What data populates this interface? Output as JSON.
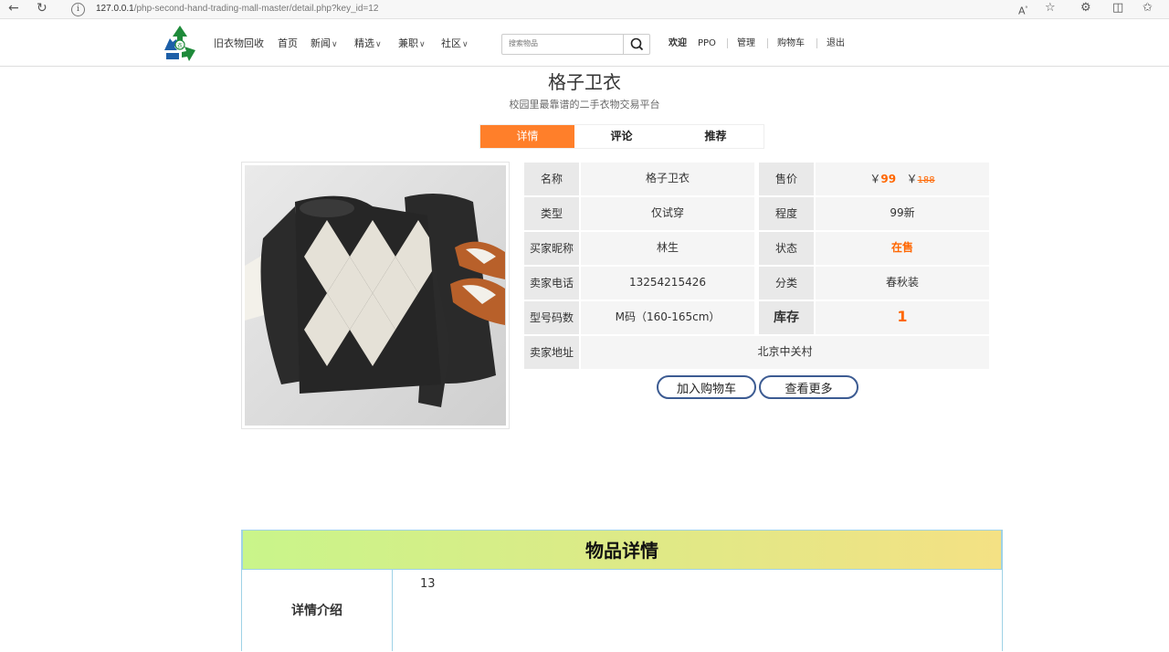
{
  "browser": {
    "url_host": "127.0.0.1",
    "url_path": "/php-second-hand-trading-mall-master/detail.php?key_id=12"
  },
  "site": {
    "brand": "旧衣物回收",
    "nav": [
      {
        "label": "首页",
        "has_caret": false
      },
      {
        "label": "新闻",
        "has_caret": true
      },
      {
        "label": "精选",
        "has_caret": true
      },
      {
        "label": "兼职",
        "has_caret": true
      },
      {
        "label": "社区",
        "has_caret": true
      }
    ],
    "search_placeholder": "搜索物品",
    "welcome": "欢迎",
    "username": "PPO",
    "links": {
      "manage": "管理",
      "cart": "购物车",
      "logout": "退出"
    }
  },
  "product": {
    "title": "格子卫衣",
    "subtitle": "校园里最靠谱的二手衣物交易平台",
    "tabs": [
      {
        "label": "详情",
        "active": true
      },
      {
        "label": "评论",
        "active": false
      },
      {
        "label": "推荐",
        "active": false
      }
    ],
    "rows": [
      {
        "l1": "名称",
        "v1": "格子卫衣",
        "l2": "售价",
        "price": "99",
        "orig": "188",
        "currency": "￥"
      },
      {
        "l1": "类型",
        "v1": "仅试穿",
        "l2": "程度",
        "v2": "99新"
      },
      {
        "l1": "买家昵称",
        "v1": "林生",
        "l2": "状态",
        "v2": "在售"
      },
      {
        "l1": "卖家电话",
        "v1": "13254215426",
        "l2": "分类",
        "v2": "春秋装"
      },
      {
        "l1": "型号码数",
        "v1": "M码（160-165cm）",
        "l2": "库存",
        "v2": "1"
      }
    ],
    "address_label": "卖家地址",
    "address": "北京中关村",
    "buttons": {
      "add_cart": "加入购物车",
      "more": "查看更多"
    }
  },
  "detail": {
    "heading": "物品详情",
    "intro_label": "详情介绍",
    "intro_value": "13"
  },
  "colors": {
    "accent": "#ff7f2a",
    "price": "#ff6600",
    "button_border": "#3c5b92"
  }
}
